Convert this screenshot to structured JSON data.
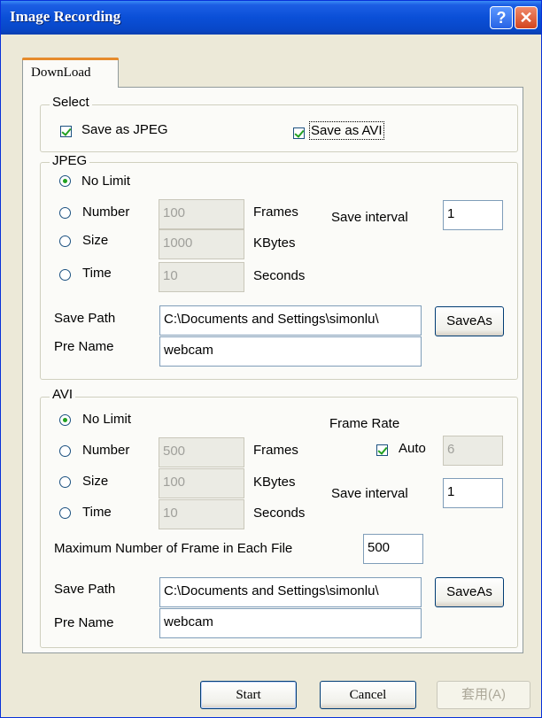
{
  "window": {
    "title": "Image Recording"
  },
  "tabs": [
    {
      "label": "DownLoad"
    }
  ],
  "select_group": {
    "title": "Select",
    "save_jpeg": {
      "label": "Save as JPEG",
      "checked": true
    },
    "save_avi": {
      "label": "Save as AVI",
      "checked": true
    }
  },
  "jpeg": {
    "title": "JPEG",
    "no_limit": "No Limit",
    "number": {
      "label": "Number",
      "value": "100",
      "unit": "Frames"
    },
    "size": {
      "label": "Size",
      "value": "1000",
      "unit": "KBytes"
    },
    "time": {
      "label": "Time",
      "value": "10",
      "unit": "Seconds"
    },
    "save_interval": {
      "label": "Save interval",
      "value": "1"
    },
    "save_path": {
      "label": "Save Path",
      "value": "C:\\Documents and Settings\\simonlu\\",
      "button": "SaveAs"
    },
    "pre_name": {
      "label": "Pre Name",
      "value": "webcam"
    }
  },
  "avi": {
    "title": "AVI",
    "no_limit": "No Limit",
    "number": {
      "label": "Number",
      "value": "500",
      "unit": "Frames"
    },
    "size": {
      "label": "Size",
      "value": "100",
      "unit": "KBytes"
    },
    "time": {
      "label": "Time",
      "value": "10",
      "unit": "Seconds"
    },
    "frame_rate": {
      "label": "Frame Rate",
      "auto_label": "Auto",
      "auto_checked": true,
      "value": "6"
    },
    "save_interval": {
      "label": "Save interval",
      "value": "1"
    },
    "max_frames": {
      "label": "Maximum Number of Frame in Each File",
      "value": "500"
    },
    "save_path": {
      "label": "Save Path",
      "value": "C:\\Documents and Settings\\simonlu\\",
      "button": "SaveAs"
    },
    "pre_name": {
      "label": "Pre Name",
      "value": "webcam"
    }
  },
  "buttons": {
    "start": "Start",
    "cancel": "Cancel",
    "apply": "套用(A)"
  }
}
